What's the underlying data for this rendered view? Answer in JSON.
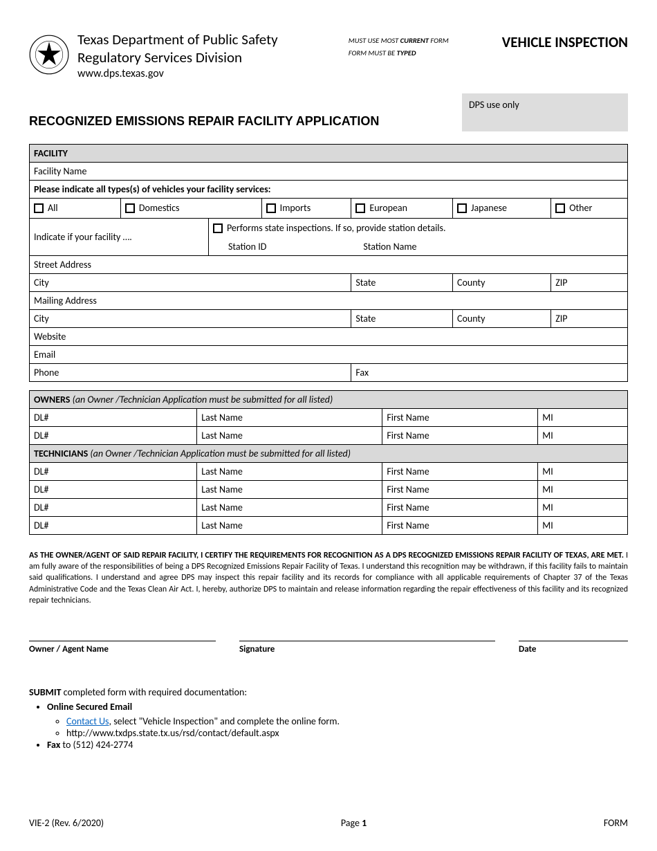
{
  "header": {
    "dept_line1": "Texas Department of Public Safety",
    "dept_line2": "Regulatory Services Division",
    "gov": "www.dps.texas.gov",
    "note1a": "MUST USE MOST ",
    "note1b": "CURRENT",
    "note1c": " FORM",
    "note2a": "FORM MUST BE ",
    "note2b": "TYPED",
    "right_title": "VEHICLE INSPECTION",
    "dpsuse": "DPS use only"
  },
  "form_title": "RECOGNIZED EMISSIONS REPAIR FACILITY APPLICATION",
  "facility": {
    "head": "FACILITY",
    "facility_name": "Facility Name",
    "types_instr": "Please indicate all types(s) of vehicles your facility services:",
    "cb": [
      "All",
      "Domestics",
      "Imports",
      "European",
      "Japanese",
      "Other"
    ],
    "indicate": "Indicate if your facility ….",
    "performs": "Performs state inspections. If so, provide station details.",
    "station_id": "Station ID",
    "station_name": "Station Name",
    "street": "Street Address",
    "city": "City",
    "state": "State",
    "county": "County",
    "zip": "ZIP",
    "mailing": "Mailing Address",
    "website": "Website",
    "email": "Email",
    "phone": "Phone",
    "fax": "Fax"
  },
  "owners": {
    "head": "OWNERS",
    "head_note": " (an Owner /Technician Application must be submitted for all listed)",
    "cols": {
      "dl": "DL#",
      "last": "Last Name",
      "first": "First Name",
      "mi": "MI"
    }
  },
  "tech": {
    "head": "TECHNICIANS",
    "head_note": " (an Owner /Technician Application must be submitted for all listed)"
  },
  "cert": {
    "bold": "AS THE OWNER/AGENT OF SAID REPAIR FACILITY, I CERTIFY THE REQUIREMENTS FOR RECOGNITION AS A DPS RECOGNIZED EMISSIONS REPAIR FACILITY OF TEXAS, ARE MET.",
    "rest": " I am fully aware of the responsibilities of being a DPS Recognized Emissions Repair Facility of Texas. I understand this recognition may be withdrawn, if this facility fails to maintain said qualifications. I understand and agree DPS may inspect this repair facility and its records for compliance with all applicable requirements of Chapter 37 of the Texas Administrative Code and the Texas Clean Air Act. I, hereby, authorize DPS to maintain and release information regarding the repair effectiveness of this facility and its recognized repair technicians."
  },
  "sig": {
    "name": "Owner / Agent Name",
    "sig": "Signature",
    "date": "Date"
  },
  "submit": {
    "lead_bold": "SUBMIT",
    "lead_rest": " completed form with required documentation:",
    "bullet1": "Online Secured Email",
    "sub1_link": "Contact Us",
    "sub1_rest": ", select \"Vehicle Inspection\" and complete the online form.",
    "sub2": "http://www.txdps.state.tx.us/rsd/contact/default.aspx",
    "bullet2_bold": "Fax",
    "bullet2_rest": " to (512) 424-2774"
  },
  "footer": {
    "left": "VIE-2 (Rev. 6/2020)",
    "center_pre": "Page ",
    "center_num": "1",
    "right": "FORM"
  }
}
